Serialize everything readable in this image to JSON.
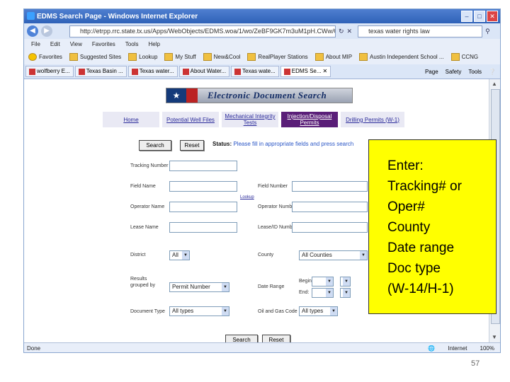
{
  "window": {
    "title": "EDMS Search Page - Windows Internet Explorer",
    "address": "http://etrpp.rrc.state.tx.us/Apps/WebObjects/EDMS.woa/1/wo/ZeBF9GK7m3uM1pH.CWw/0.5.0.1.3.1.0.15",
    "search_text": "texas water rights law"
  },
  "menu": [
    "File",
    "Edit",
    "View",
    "Favorites",
    "Tools",
    "Help"
  ],
  "favorites": [
    "Favorites",
    "Suggested Sites",
    "Lookup",
    "My Stuff",
    "New&Cool",
    "RealPlayer Stations",
    "About MIP",
    "Austin Independent School ...",
    "CCNG"
  ],
  "tabs": [
    "wolfberry E...",
    "Texas Basin ...",
    "Texas water...",
    "About Water...",
    "Texas wate...",
    "EDMS Se..."
  ],
  "toolbar_right": [
    "Page",
    "Safety",
    "Tools"
  ],
  "statusbar": {
    "left": "Done",
    "zone": "Internet",
    "zoom": "100%"
  },
  "page": {
    "logo_text": "Electronic Document Search",
    "nav_tabs": [
      "Home",
      "Potential Well Files",
      "Mechanical Integrity Tests",
      "Injection/Disposal Permits",
      "Drilling Permits (W-1)"
    ],
    "search_button": "Search",
    "reset_top_button": "Reset",
    "status_label": "Status:",
    "status_text": "Please fill in appropriate fields and press search",
    "labels": {
      "tracking_number": "Tracking Number",
      "field_name": "Field Name",
      "field_number": "Field Number",
      "lookup": "Lookup",
      "operator_name": "Operator Name",
      "operator_number": "Operator Number",
      "lease_name": "Lease Name",
      "lease_id": "Lease/ID Number",
      "district": "District",
      "county": "County",
      "results_grouped_by": "Results grouped by",
      "date_range": "Date Range",
      "begin": "Begin:",
      "end": "End:",
      "document_type": "Document Type",
      "oil_gas_code": "Oil and Gas Code"
    },
    "selects": {
      "district": "All",
      "county": "All Counties",
      "results_grouped_by": "Permit Number",
      "document_type": "All types",
      "oil_gas_code": "All types"
    },
    "bottom_search": "Search",
    "bottom_reset": "Reset"
  },
  "callout": {
    "lines": [
      "Enter:",
      "Tracking# or",
      "Oper#",
      "County",
      "Date range",
      "Doc type",
      "(W-14/H-1)"
    ],
    "color": "#ffff00"
  },
  "slide_number": "57"
}
